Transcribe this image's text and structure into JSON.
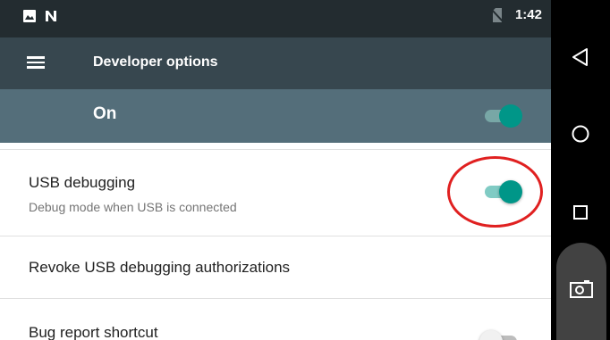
{
  "status_bar": {
    "time": "1:42",
    "icons": [
      "image-icon",
      "n-logo-icon",
      "no-sim-icon"
    ]
  },
  "toolbar": {
    "title": "Developer options",
    "menu_icon": "hamburger-menu-icon"
  },
  "master_switch": {
    "label": "On",
    "checked": true
  },
  "settings": {
    "usb_debugging": {
      "title": "USB debugging",
      "summary": "Debug mode when USB is connected",
      "checked": true
    },
    "revoke": {
      "title": "Revoke USB debugging authorizations"
    },
    "bug_report": {
      "title": "Bug report shortcut",
      "checked": false
    }
  },
  "nav_bar": {
    "buttons": [
      "back-icon",
      "home-icon",
      "recents-icon",
      "camera-icon"
    ]
  },
  "colors": {
    "status_bar": "#232c30",
    "toolbar": "#37474f",
    "master_bar": "#546e7a",
    "accent": "#009688",
    "annotation": "#e02020"
  }
}
